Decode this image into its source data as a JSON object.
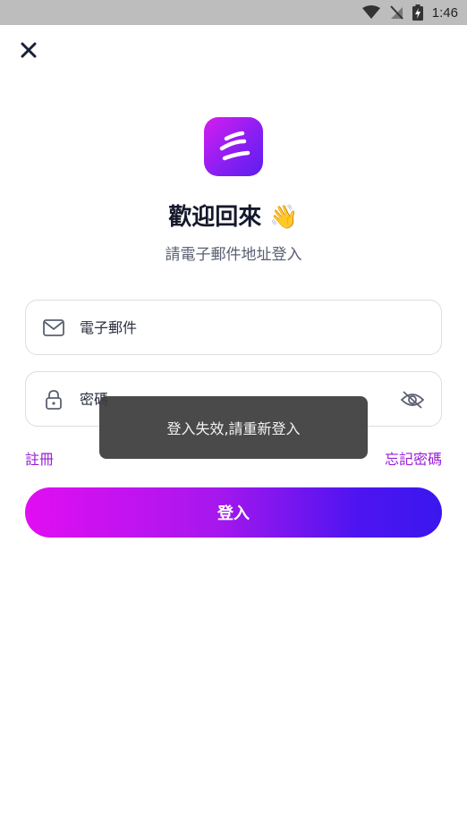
{
  "status_bar": {
    "time": "1:46"
  },
  "icons": {
    "wifi": "wifi-icon",
    "signal": "no-signal-icon",
    "battery": "battery-charging-icon",
    "close": "close-icon",
    "logo": "app-logo",
    "wave": "waving-hand-emoji",
    "email": "mail-icon",
    "lock": "lock-icon",
    "eye": "eye-off-icon"
  },
  "header": {
    "title": "歡迎回來 👋",
    "subtitle": "請電子郵件地址登入"
  },
  "form": {
    "email_placeholder": "電子郵件",
    "email_value": "",
    "password_placeholder": "密碼",
    "password_value": ""
  },
  "links": {
    "register": "註冊",
    "forgot_password": "忘記密碼"
  },
  "login_button": {
    "label": "登入"
  },
  "toast": {
    "message": "登入失效,請重新登入"
  },
  "colors": {
    "accent_purple": "#9a1ed6",
    "gradient_start": "#e10ef2",
    "gradient_end": "#3a17ee",
    "toast_bg": "#3c3c3c"
  }
}
